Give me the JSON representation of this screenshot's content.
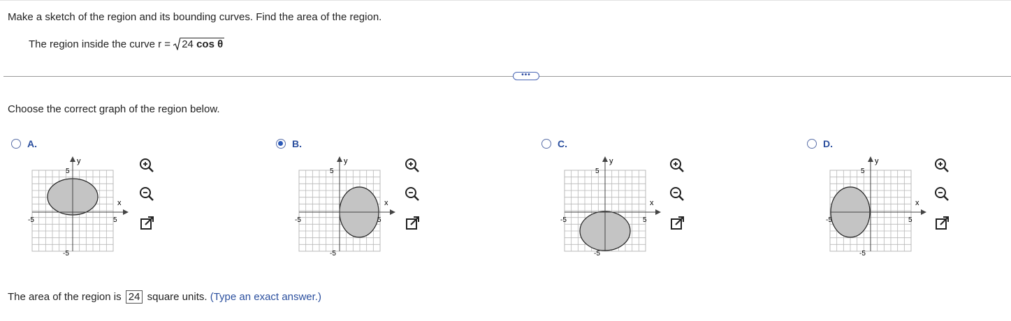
{
  "question": "Make a sketch of the region and its bounding curves. Find the area of the region.",
  "subquestion": {
    "prefix": "The region inside the curve r =",
    "radicand_number": "24",
    "radicand_func": "cos θ"
  },
  "more_button": "•••",
  "prompt": "Choose the correct graph of the region below.",
  "options": [
    {
      "label": "A.",
      "selected": false
    },
    {
      "label": "B.",
      "selected": true
    },
    {
      "label": "C.",
      "selected": false
    },
    {
      "label": "D.",
      "selected": false
    }
  ],
  "graph_labels": {
    "y": "y",
    "x": "x",
    "pos": "5",
    "neg": "-5"
  },
  "answer": {
    "prefix": "The area of the region is",
    "value": "24",
    "suffix": "square units.",
    "hint": "(Type an exact answer.)"
  },
  "colors": {
    "region_fill": "#c4c4c4",
    "grid": "#b8b8b8",
    "accent": "#2b4f9e"
  },
  "icons": [
    "zoom-in-icon",
    "zoom-out-icon",
    "open-new-window-icon"
  ]
}
